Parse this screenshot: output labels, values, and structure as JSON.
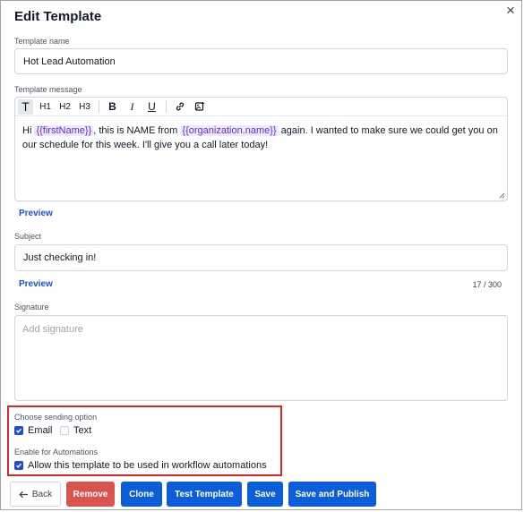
{
  "dialog": {
    "title": "Edit Template",
    "close_glyph": "×"
  },
  "template_name": {
    "label": "Template name",
    "value": "Hot Lead Automation"
  },
  "template_message": {
    "label": "Template message",
    "toolbar": {
      "text": "T",
      "h1": "H1",
      "h2": "H2",
      "h3": "H3",
      "bold": "B",
      "italic": "I",
      "underline": "U"
    },
    "body": {
      "part1": "Hi ",
      "tag1": "{{firstName}}",
      "part2": ", this is NAME from ",
      "tag2": "{{organization.name}}",
      "part3": " again. I wanted to make sure we could get you on our schedule for this week. I'll give you a call later today!"
    },
    "preview_label": "Preview"
  },
  "subject": {
    "label": "Subject",
    "value": "Just checking in!",
    "preview_label": "Preview",
    "counter": "17 / 300"
  },
  "signature": {
    "label": "Signature",
    "placeholder": "Add signature"
  },
  "sending_option": {
    "label": "Choose sending option",
    "email": {
      "label": "Email",
      "checked": true
    },
    "text": {
      "label": "Text",
      "checked": false
    }
  },
  "automations": {
    "label": "Enable for Automations",
    "option": {
      "label": "Allow this template to be used in workflow automations",
      "checked": true
    }
  },
  "buttons": {
    "back": "Back",
    "remove": "Remove",
    "clone": "Clone",
    "test": "Test Template",
    "save": "Save",
    "save_publish": "Save and Publish"
  },
  "colors": {
    "primary": "#0b5ed7",
    "danger": "#d9534f",
    "highlight": "#dc2626",
    "tag_bg": "#ede9fe",
    "tag_text": "#6d28d9"
  }
}
